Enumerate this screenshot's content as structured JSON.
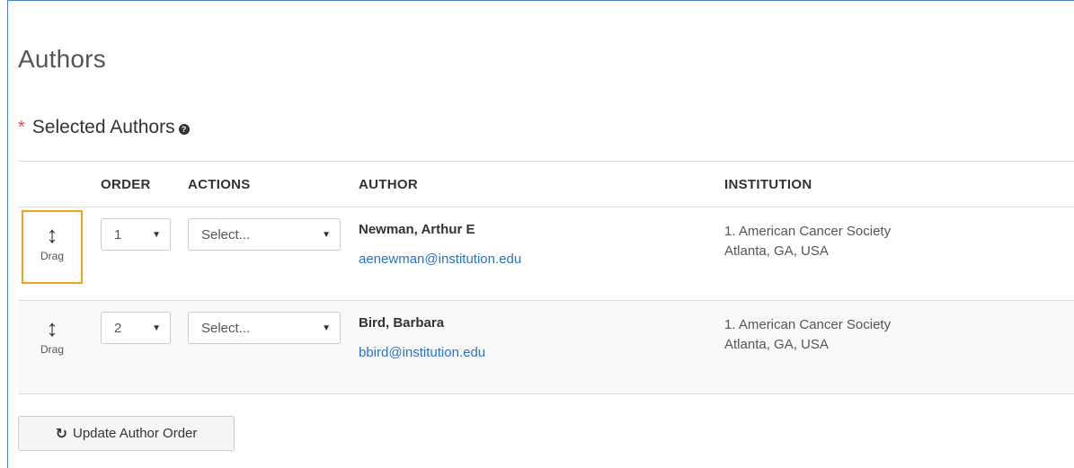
{
  "page": {
    "title": "Authors",
    "section_title": "Selected Authors",
    "required_marker": "*",
    "help_icon": "?"
  },
  "table": {
    "headers": {
      "drag": "",
      "order": "ORDER",
      "actions": "ACTIONS",
      "author": "AUTHOR",
      "institution": "INSTITUTION"
    },
    "rows": [
      {
        "drag_label": "Drag",
        "order": "1",
        "action_placeholder": "Select...",
        "author_name": "Newman, Arthur E",
        "author_email": "aenewman@institution.edu",
        "institution_line1": "1. American Cancer Society",
        "institution_line2": "Atlanta, GA, USA"
      },
      {
        "drag_label": "Drag",
        "order": "2",
        "action_placeholder": "Select...",
        "author_name": "Bird, Barbara",
        "author_email": "bbird@institution.edu",
        "institution_line1": "1. American Cancer Society",
        "institution_line2": "Atlanta, GA, USA"
      }
    ]
  },
  "buttons": {
    "update_order": "Update Author Order"
  },
  "icons": {
    "drag": "vertical-arrows-icon",
    "caret": "caret-down-icon",
    "refresh": "refresh-icon",
    "help": "question-circle-icon"
  },
  "colors": {
    "link": "#2a73c0",
    "required": "#d9534f",
    "focus_outline": "#f0a020",
    "frame_border": "#4a7fc1"
  }
}
